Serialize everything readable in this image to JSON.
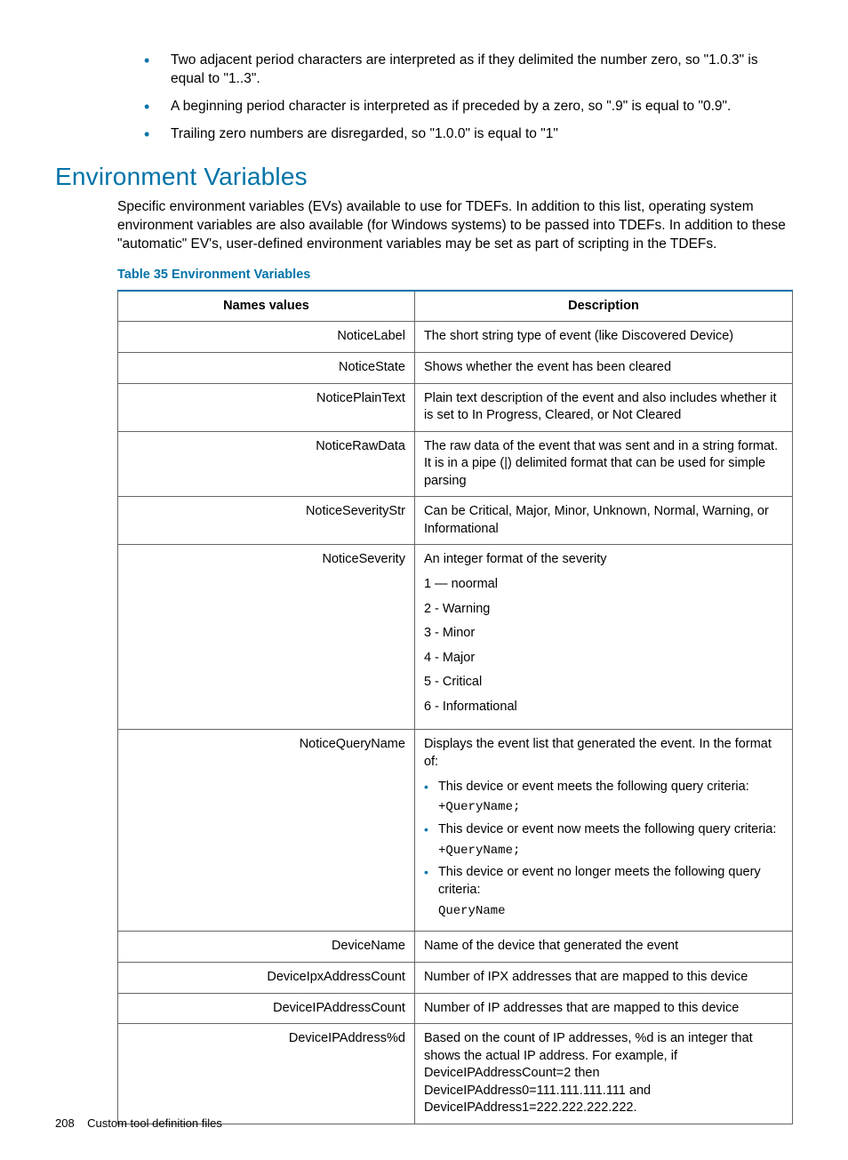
{
  "bullets": [
    "Two adjacent period characters are interpreted as if they delimited the number zero, so \"1.0.3\" is equal to \"1..3\".",
    "A beginning period character is interpreted as if preceded by a zero, so \".9\" is equal to \"0.9\".",
    "Trailing zero numbers are disregarded, so \"1.0.0\" is equal to \"1\""
  ],
  "heading": "Environment Variables",
  "intro": "Specific environment variables (EVs) available to use for TDEFs. In addition to this list, operating system environment variables are also available (for Windows systems) to be passed into TDEFs. In addition to these \"automatic\" EV's, user-defined environment variables may be set as part of scripting in the TDEFs.",
  "table_caption": "Table 35 Environment Variables",
  "columns": {
    "names": "Names values",
    "desc": "Description"
  },
  "rows": [
    {
      "name": "NoticeLabel",
      "desc": "The short string type of event (like Discovered Device)"
    },
    {
      "name": "NoticeState",
      "desc": "Shows whether the event has been cleared"
    },
    {
      "name": "NoticePlainText",
      "desc": "Plain text description of the event and also includes whether it is set to In Progress, Cleared, or Not Cleared"
    },
    {
      "name": "NoticeRawData",
      "desc": "The raw data of the event that was sent and in a string format. It is in a pipe (|) delimited format that can be used for simple parsing"
    },
    {
      "name": "NoticeSeverityStr",
      "desc": "Can be Critical, Major, Minor, Unknown, Normal, Warning, or Informational"
    },
    {
      "name": "NoticeSeverity",
      "desc_lead": "An integer format of the severity",
      "lines": [
        "1 — noormal",
        "2 - Warning",
        "3 - Minor",
        "4 - Major",
        "5 - Critical",
        "6 - Informational"
      ]
    },
    {
      "name": "NoticeQueryName",
      "desc_lead": "Displays the event list that generated the event. In the format of:",
      "items": [
        {
          "text": "This device or event meets the following query criteria:",
          "code": "+QueryName;"
        },
        {
          "text": "This device or event now meets the following query criteria:",
          "code": "+QueryName;"
        },
        {
          "text": "This device or event no longer meets the following query criteria:",
          "code": "QueryName"
        }
      ]
    },
    {
      "name": "DeviceName",
      "desc": "Name of the device that generated the event"
    },
    {
      "name": "DeviceIpxAddressCount",
      "desc": "Number of IPX addresses that are mapped to this device"
    },
    {
      "name": "DeviceIPAddressCount",
      "desc": "Number of IP addresses that are mapped to this device"
    },
    {
      "name": "DeviceIPAddress%d",
      "desc": "Based on the count of IP addresses, %d is an integer that shows the actual IP address. For example, if DeviceIPAddressCount=2 then DeviceIPAddress0=111.111.111.111 and DeviceIPAddress1=222.222.222.222."
    }
  ],
  "footer": {
    "page": "208",
    "title": "Custom tool definition files"
  }
}
